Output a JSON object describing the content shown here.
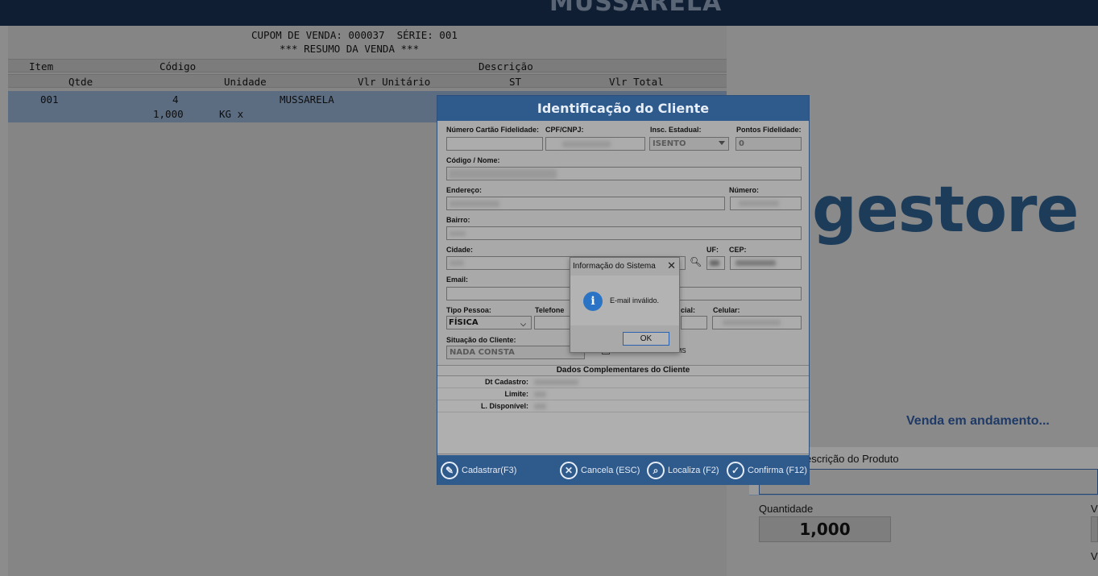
{
  "header": {
    "product_name": "MUSSARELA"
  },
  "receipt": {
    "cupom_line": "CUPOM DE VENDA: 000037  SÉRIE: 001",
    "resumo_line": "*** RESUMO DA VENDA ***",
    "col_item": "Item",
    "col_codigo": "Código",
    "col_descricao": "Descrição",
    "col_qtde": "Qtde",
    "col_unidade": "Unidade",
    "col_vlr_unitario": "Vlr Unitário",
    "col_st": "ST",
    "col_vlr_total": "Vlr Total",
    "items": [
      {
        "item": "001",
        "codigo": "4",
        "descricao": "MUSSARELA",
        "qtde": "1,000",
        "unidade": "KG x"
      }
    ]
  },
  "right_panel": {
    "logo": "gestore",
    "status": "Venda em andamento...",
    "desc_label": "escrição do Produto",
    "qty_label": "Quantidade",
    "qty_value": "1,000",
    "val_label_1": "V",
    "val_label_2": "V"
  },
  "dialog": {
    "title": "Identificação do Cliente",
    "fields": {
      "cartao_label": "Número Cartão Fidelidade:",
      "cpf_label": "CPF/CNPJ:",
      "insc_label": "Insc. Estadual:",
      "insc_value": "ISENTO",
      "pontos_label": "Pontos Fidelidade:",
      "pontos_value": "0",
      "codigo_nome_label": "Código / Nome:",
      "endereco_label": "Endereço:",
      "numero_label": "Número:",
      "bairro_label": "Bairro:",
      "cidade_label": "Cidade:",
      "uf_label": "UF:",
      "cep_label": "CEP:",
      "email_label": "Email:",
      "tipo_pessoa_label": "Tipo Pessoa:",
      "tipo_pessoa_value": "FÍSICA",
      "telefone_label": "Telefone",
      "comercial_label": "cial:",
      "celular_label": "Celular:",
      "situacao_label": "Situação do Cliente:",
      "situacao_value": "NADA CONSTA",
      "icms_label": "Não contribuinte do ICMS"
    },
    "complementares": {
      "title": "Dados Complementares do Cliente",
      "dt_cadastro_label": "Dt Cadastro:",
      "limite_label": "Limite:",
      "disponivel_label": "L. Disponível:"
    },
    "footer": {
      "cadastrar": "Cadastrar(F3)",
      "cancela": "Cancela (ESC)",
      "localiza": "Localiza (F2)",
      "confirma": "Confirma (F12)"
    }
  },
  "message_box": {
    "title": "Informação do Sistema",
    "close": "✕",
    "message": "E-mail inválido.",
    "ok": "OK"
  },
  "colors": {
    "accent": "#2f5a8c",
    "info": "#2b73c5",
    "top_bar": "#0f1e32"
  }
}
